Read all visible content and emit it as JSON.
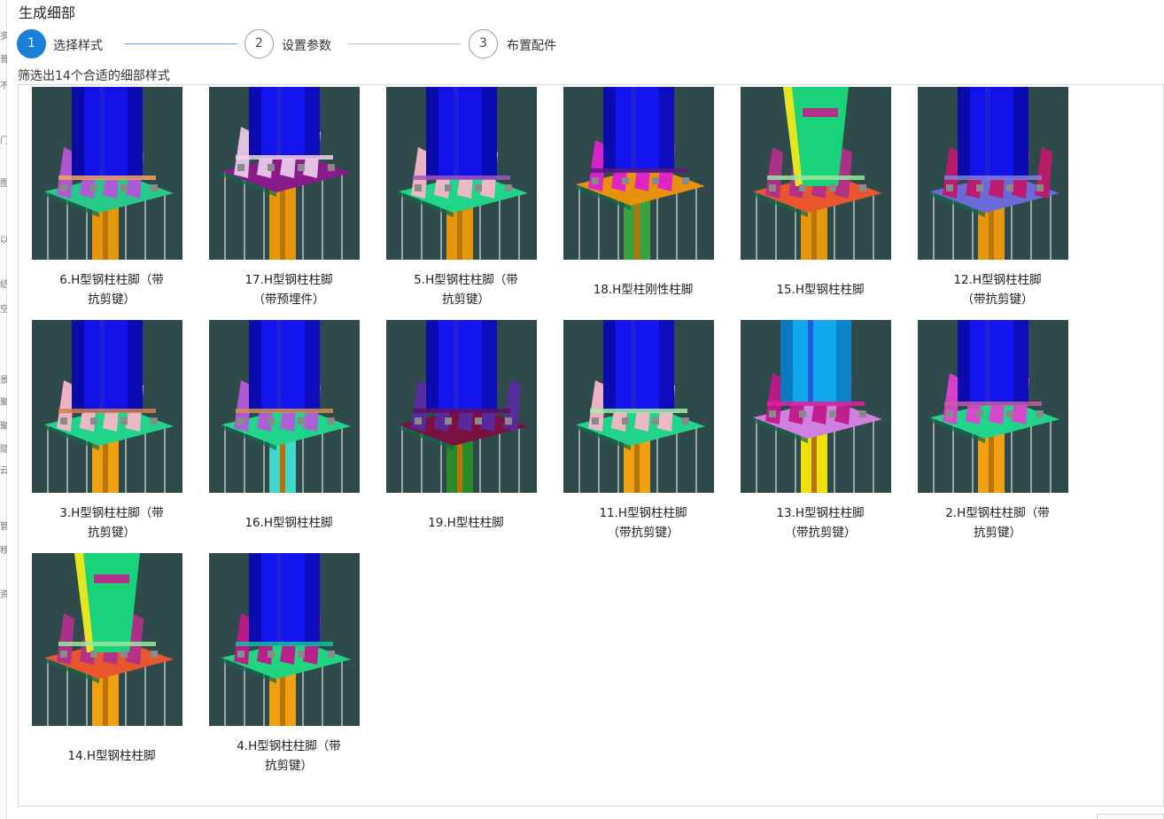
{
  "dialog": {
    "title": "生成细部",
    "filter_text": "筛选出14个合适的细部样式"
  },
  "steps": [
    {
      "number": "1",
      "label": "选择样式",
      "active": true
    },
    {
      "number": "2",
      "label": "设置参数",
      "active": false
    },
    {
      "number": "3",
      "label": "布置配件",
      "active": false
    }
  ],
  "left_strip_chars": [
    "多",
    "普",
    "不",
    "门",
    "图",
    "以",
    "结",
    "空",
    "景",
    "聚",
    "聚",
    "隐",
    "云",
    "管",
    "移",
    "资"
  ],
  "styles": [
    {
      "label": "6.H型钢柱柱脚（带抗剪键）",
      "variant": "ribbed-purple"
    },
    {
      "label": "17.H型钢柱柱脚（带预埋件）",
      "variant": "embedded"
    },
    {
      "label": "5.H型钢柱柱脚（带抗剪键）",
      "variant": "pink-ribs"
    },
    {
      "label": "18.H型柱刚性柱脚",
      "variant": "rigid-magenta"
    },
    {
      "label": "15.H型钢柱柱脚",
      "variant": "green-column"
    },
    {
      "label": "12.H型钢柱柱脚（带抗剪键）",
      "variant": "blue-plate"
    },
    {
      "label": "3.H型钢柱柱脚（带抗剪键）",
      "variant": "pink-boxes"
    },
    {
      "label": "16.H型钢柱柱脚",
      "variant": "purple-boxes"
    },
    {
      "label": "19.H型柱柱脚",
      "variant": "dark-ribs"
    },
    {
      "label": "11.H型钢柱柱脚（带抗剪键）",
      "variant": "pink-green"
    },
    {
      "label": "13.H型钢柱柱脚（带抗剪键）",
      "variant": "cyan-column"
    },
    {
      "label": "2.H型钢柱柱脚（带抗剪键）",
      "variant": "small-ribs"
    },
    {
      "label": "14.H型钢柱柱脚",
      "variant": "green-tilt"
    },
    {
      "label": "4.H型钢柱柱脚（带抗剪键）",
      "variant": "green-plate"
    }
  ],
  "colors": {
    "thumb_bg": "#2f4a4a",
    "accent": "#1a7fd6",
    "steel_blue": "#1010e0",
    "shear_key_orange": "#e09a10"
  }
}
